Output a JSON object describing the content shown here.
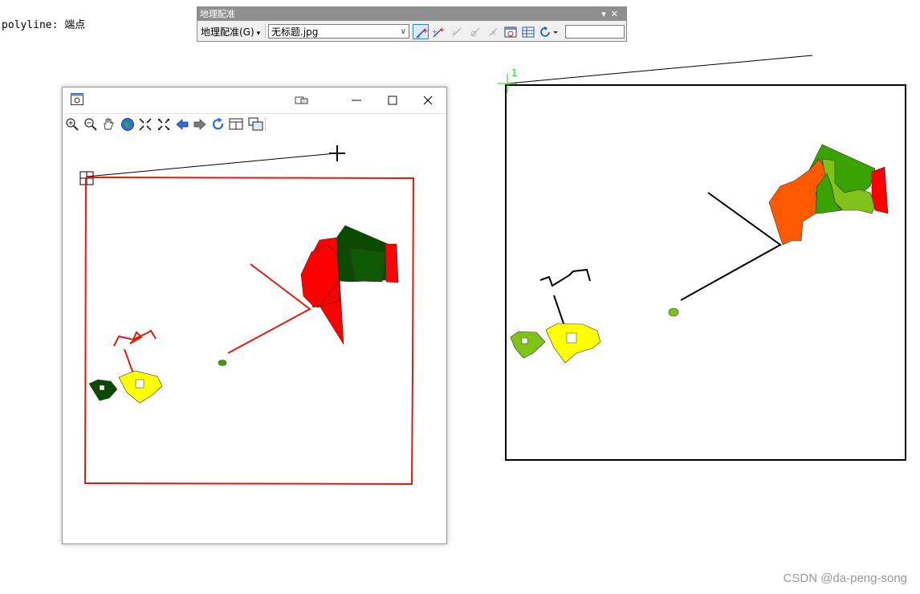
{
  "caption": "polyline: 端点",
  "watermark": "CSDN @da-peng-song",
  "georef_toolbar": {
    "title": "地理配准",
    "menu_label": "地理配准(G)",
    "layer_select_value": "无标题.jpg",
    "tools": [
      "add-control-points-icon",
      "add-control-points-multi-icon",
      "select-link-icon",
      "zoom-to-link-icon",
      "delete-link-icon",
      "viewer-icon",
      "link-table-icon",
      "rotate-icon"
    ],
    "field_value": ""
  },
  "viewer_window": {
    "tools": [
      "zoom-in-icon",
      "zoom-out-icon",
      "pan-icon",
      "full-extent-icon",
      "fixed-zoom-in-icon",
      "fixed-zoom-out-icon",
      "back-icon",
      "forward-icon",
      "refresh-icon",
      "link-window-icon",
      "toggle-window-icon"
    ]
  },
  "map": {
    "control_point_label": "1"
  },
  "colors": {
    "red_outline": "#e11a0f",
    "orange": "#ff5a00",
    "green": "#3aa300",
    "light_green": "#7fc21a",
    "dark_green": "#0a4b00",
    "yellow": "#ffff00",
    "control_point": "#19d219"
  }
}
